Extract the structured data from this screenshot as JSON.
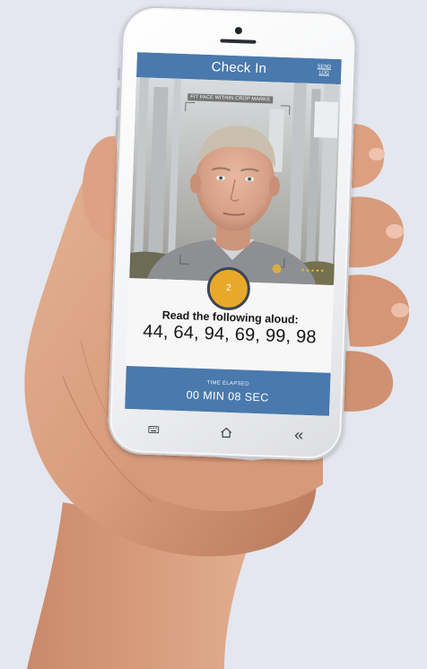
{
  "header": {
    "title": "Check In",
    "send_log_line1": "SEND",
    "send_log_line2": "LOG"
  },
  "camera": {
    "instruction": "FIT FACE WITHIN CROP MARKS",
    "countdown": "2"
  },
  "prompt": {
    "label": "Read the following aloud:",
    "digits": "44, 64, 94, 69, 99, 98"
  },
  "timer": {
    "label": "TIME ELAPSED",
    "value": "00 MIN  08 SEC"
  },
  "navbar": {
    "back_glyph": "«",
    "icons": [
      "keyboard-icon",
      "home-icon",
      "back-icon"
    ]
  },
  "colors": {
    "header_blue": "#4a79ad",
    "counter_orange": "#e8a92a",
    "background": "#e4e7ef"
  }
}
